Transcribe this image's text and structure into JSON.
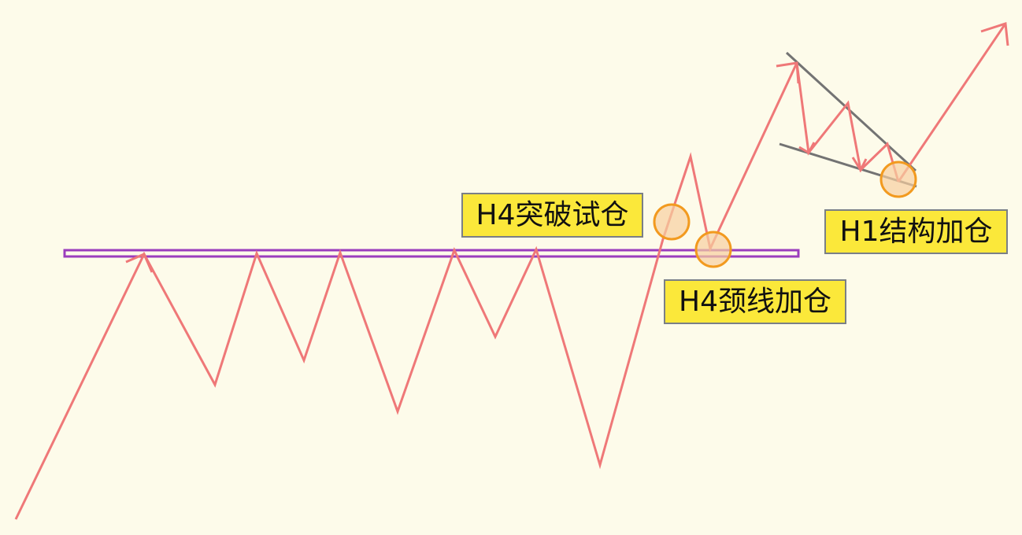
{
  "colors": {
    "background": "#fdfbea",
    "price_path": "#ef7878",
    "neckline": "#9b3dbd",
    "trendline": "#737373",
    "marker_stroke": "#f29a1f",
    "marker_fill": "#f7cfa0",
    "label_fill": "#fbe83a",
    "label_border": "#7a7f86"
  },
  "labels": {
    "breakout_trial": "H4突破试仓",
    "neckline_add": "H4颈线加仓",
    "structure_add": "H1结构加仓"
  }
}
